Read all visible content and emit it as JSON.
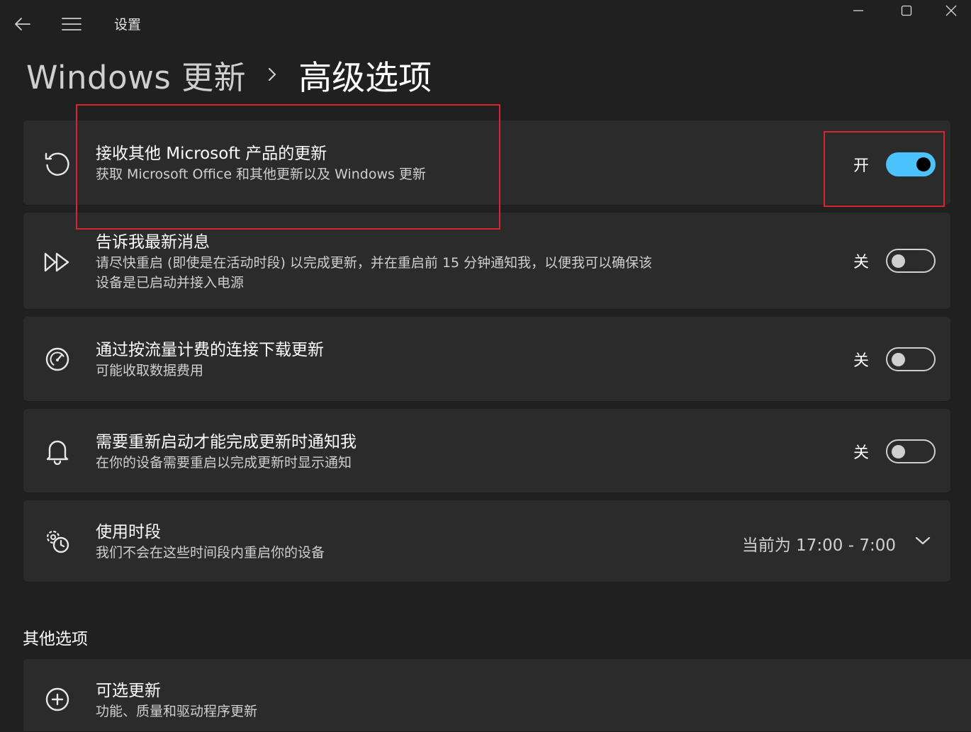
{
  "app": {
    "title": "设置"
  },
  "breadcrumb": {
    "parent": "Windows 更新",
    "separator": "›",
    "current": "高级选项"
  },
  "settings": [
    {
      "icon": "refresh-icon",
      "title": "接收其他 Microsoft 产品的更新",
      "description": "获取 Microsoft Office 和其他更新以及 Windows 更新",
      "toggle_label": "开",
      "toggle_on": true
    },
    {
      "icon": "fast-forward-icon",
      "title": "告诉我最新消息",
      "description_line1": "请尽快重启 (即使是在活动时段) 以完成更新，并在重启前 15 分钟通知我，以便我可以确保该",
      "description_line2": "设备是已启动并接入电源",
      "toggle_label": "关",
      "toggle_on": false
    },
    {
      "icon": "speedometer-icon",
      "title": "通过按流量计费的连接下载更新",
      "description": "可能收取数据费用",
      "toggle_label": "关",
      "toggle_on": false
    },
    {
      "icon": "bell-icon",
      "title": "需要重新启动才能完成更新时通知我",
      "description": "在你的设备需要重启以完成更新时显示通知",
      "toggle_label": "关",
      "toggle_on": false
    },
    {
      "icon": "clock-gear-icon",
      "title": "使用时段",
      "description": "我们不会在这些时间段内重启你的设备",
      "value": "当前为 17:00 - 7:00"
    }
  ],
  "other_options": {
    "heading": "其他选项",
    "items": [
      {
        "icon": "plus-circle-icon",
        "title": "可选更新",
        "description": "功能、质量和驱动程序更新"
      }
    ]
  },
  "colors": {
    "accent": "#4cc2ff",
    "highlight": "#d9262c",
    "background": "#202020",
    "card": "#2b2b2b"
  }
}
